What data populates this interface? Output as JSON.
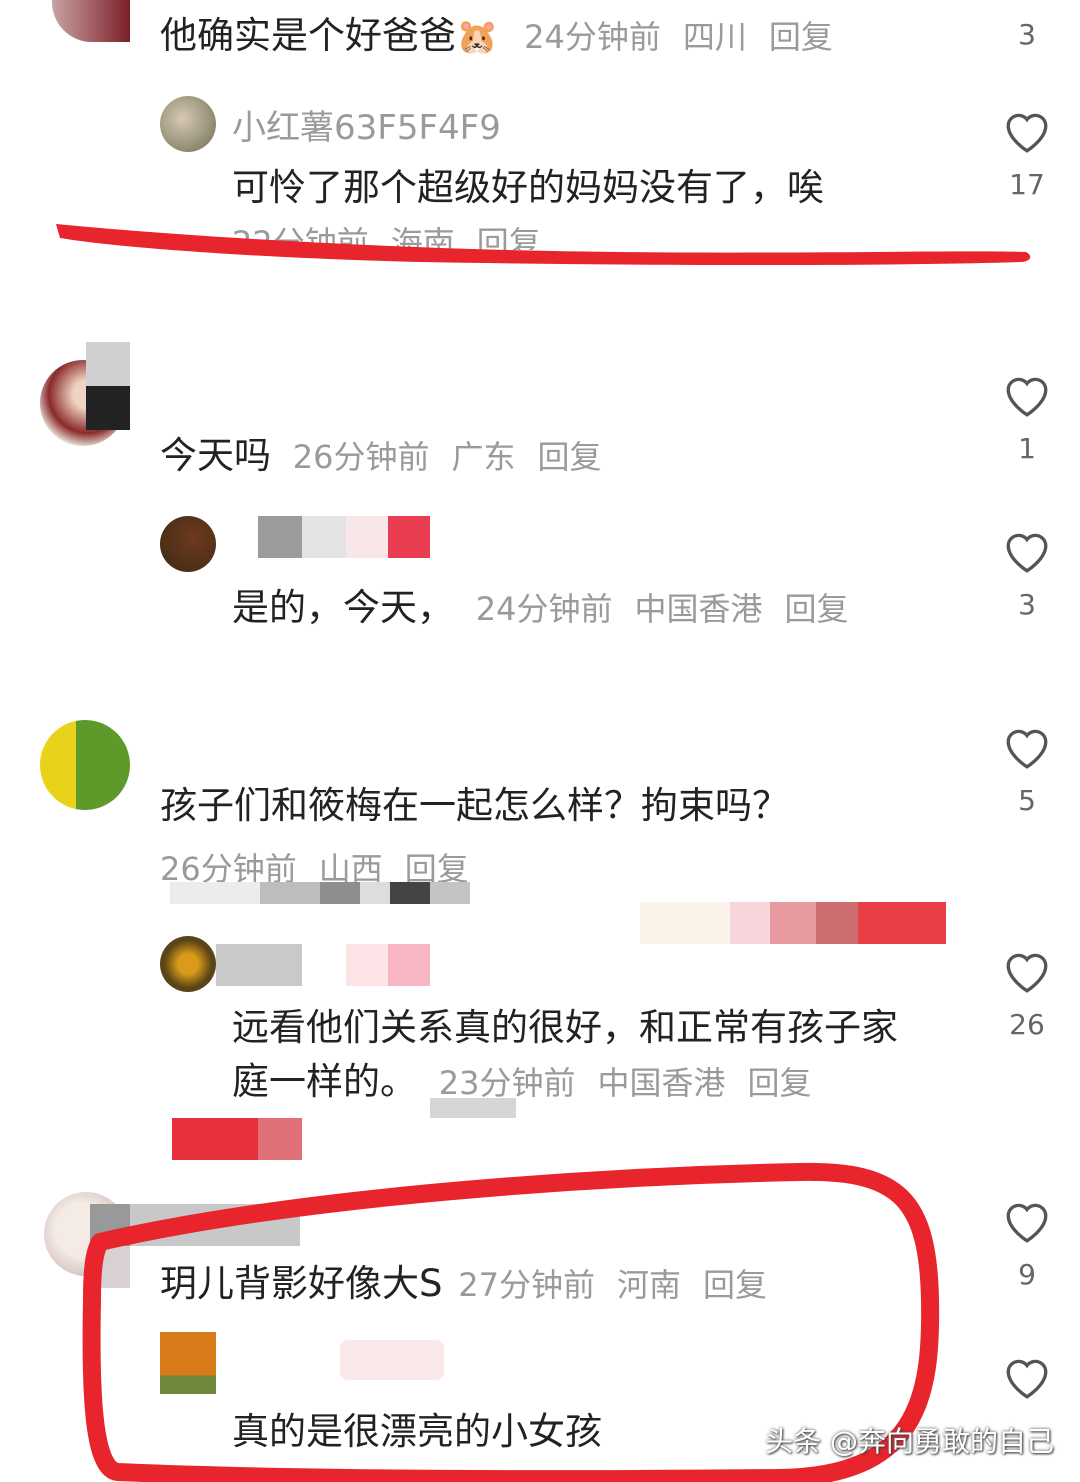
{
  "comments": [
    {
      "text": "他确实是个好爸爸",
      "emoji": "🙂",
      "time": "24分钟前",
      "region": "四川",
      "reply": "回复",
      "likes": "3"
    },
    {
      "user": "小红薯63F5F4F9",
      "text": "可怜了那个超级好的妈妈没有了，唉",
      "time": "22分钟前",
      "region": "海南",
      "reply": "回复",
      "likes": "17"
    },
    {
      "text": "今天吗",
      "time": "26分钟前",
      "region": "广东",
      "reply": "回复",
      "likes": "1"
    },
    {
      "text": "是的，今天，",
      "time": "24分钟前",
      "region": "中国香港",
      "reply": "回复",
      "likes": "3"
    },
    {
      "text": "孩子们和筱梅在一起怎么样？拘束吗？",
      "time": "26分钟前",
      "region": "山西",
      "reply": "回复",
      "likes": "5"
    },
    {
      "text_line1": "远看他们关系真的很好，和正常有孩子家",
      "text_line2": "庭一样的。",
      "time": "23分钟前",
      "region": "中国香港",
      "reply": "回复",
      "likes": "26"
    },
    {
      "text": "玥儿背影好像大S",
      "time": "27分钟前",
      "region": "河南",
      "reply": "回复",
      "likes": "9"
    },
    {
      "text": "真的是很漂亮的小女孩",
      "likes": ""
    }
  ],
  "watermark": "头条 @奔向勇敢的自己",
  "icons": {
    "like": "heart-outline-icon"
  },
  "colors": {
    "annotation_red": "#e8242c",
    "meta_gray": "#9a9a9a"
  }
}
